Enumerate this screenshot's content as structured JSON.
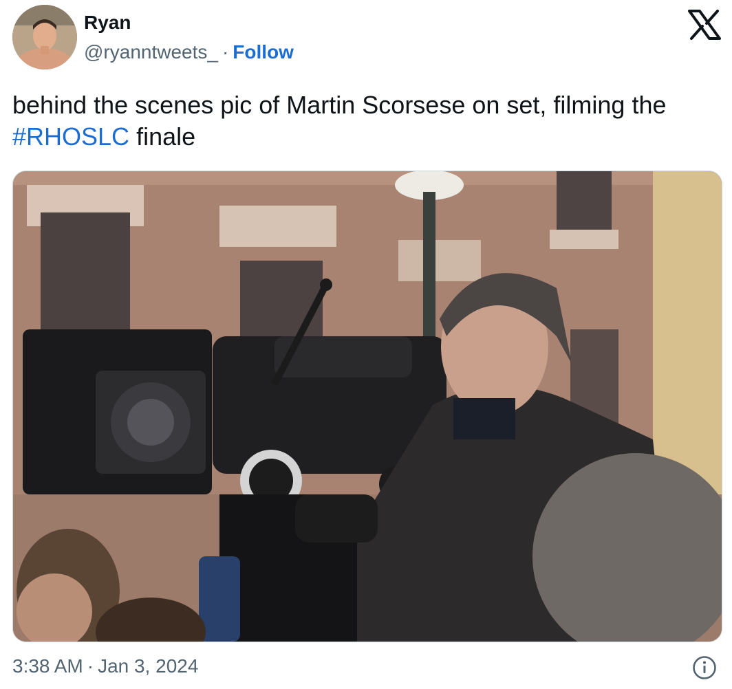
{
  "author": {
    "name": "Ryan",
    "handle": "@ryanntweets_",
    "separator": "·",
    "follow_label": "Follow",
    "avatar_icon": "profile-photo"
  },
  "brand": {
    "logo_icon": "x-logo-icon"
  },
  "tweet": {
    "text_before": "behind the scenes pic of Martin Scorsese on set, filming the",
    "hashtag": "#RHOSLC",
    "text_after": "finale",
    "media": {
      "type": "photo"
    }
  },
  "footer": {
    "time": "3:38 AM",
    "separator": "·",
    "date": "Jan 3, 2024",
    "info_icon": "info-icon"
  },
  "colors": {
    "link": "#1d6ccf",
    "text": "#0f1419",
    "muted": "#536471",
    "border": "#cfd9de"
  }
}
